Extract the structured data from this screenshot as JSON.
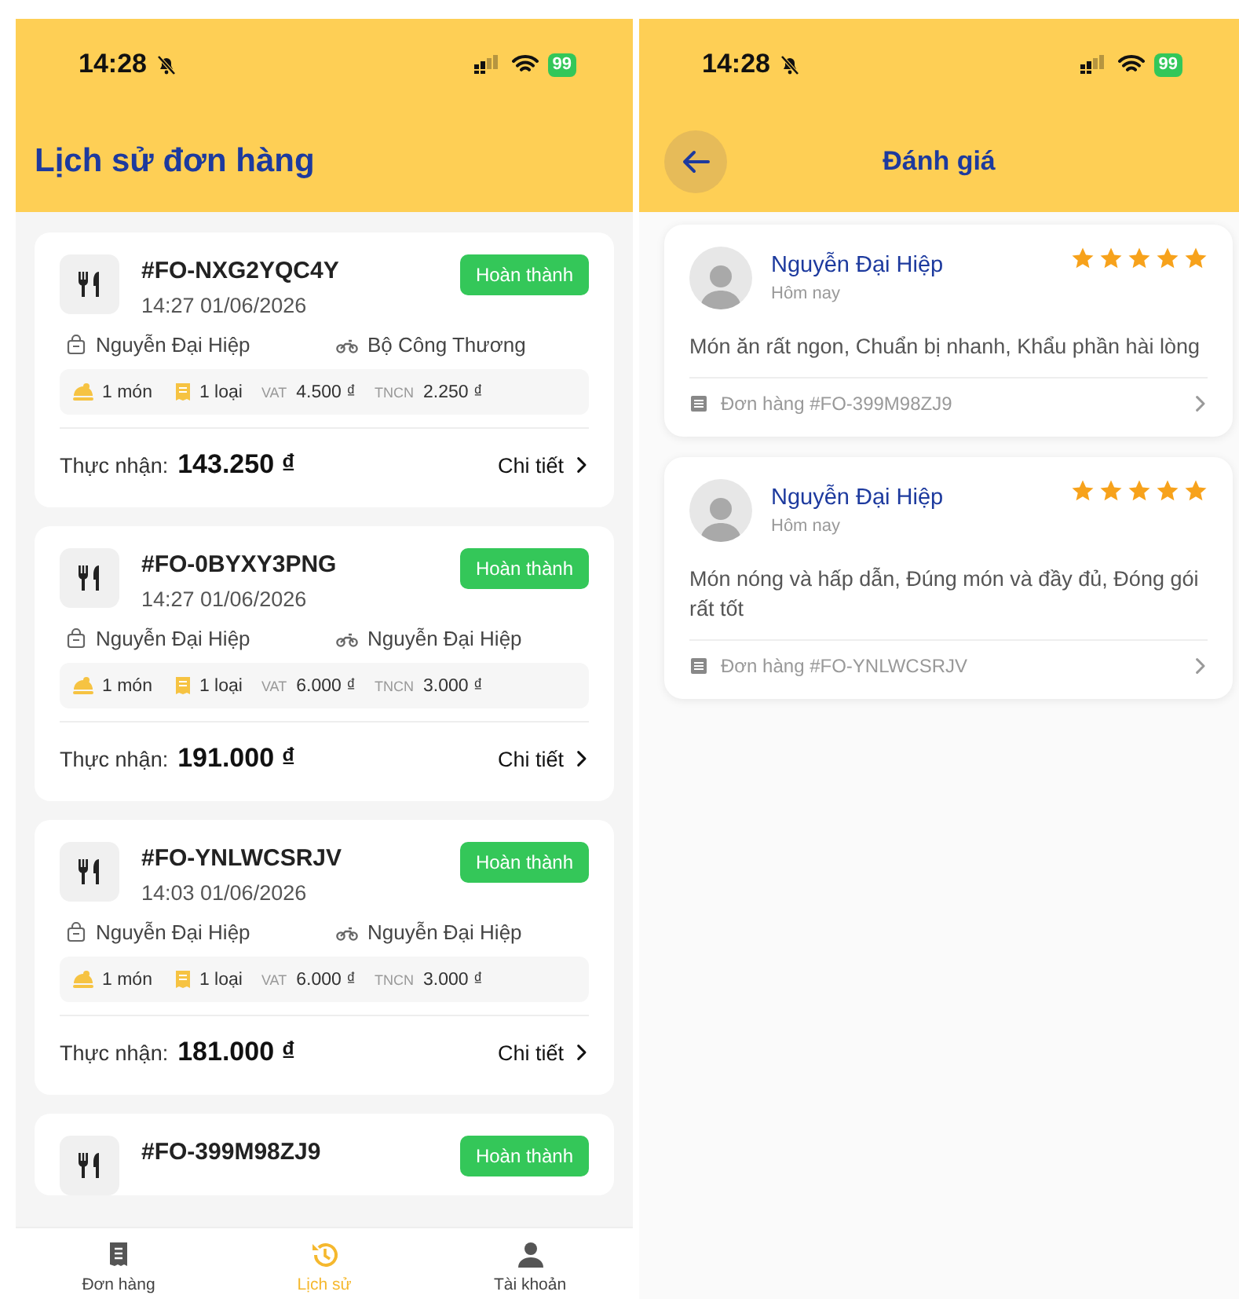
{
  "order_history": {
    "status_bar": {
      "time": "14:28",
      "battery": "99"
    },
    "title": "Lịch sử đơn hàng",
    "orders": [
      {
        "id": "#FO-NXG2YQC4Y",
        "time": "14:27 01/06/2026",
        "status": "Hoàn thành",
        "customer": "Nguyễn Đại Hiệp",
        "shipper": "Bộ Công Thương",
        "items": "1 món",
        "types": "1 loại",
        "vat_label": "VAT",
        "vat": "4.500 ₫",
        "tncn_label": "TNCN",
        "tncn": "2.250 ₫",
        "received_label": "Thực nhận:",
        "received": "143.250 ₫",
        "detail": "Chi tiết"
      },
      {
        "id": "#FO-0BYXY3PNG",
        "time": "14:27 01/06/2026",
        "status": "Hoàn thành",
        "customer": "Nguyễn Đại Hiệp",
        "shipper": "Nguyễn Đại Hiệp",
        "items": "1 món",
        "types": "1 loại",
        "vat_label": "VAT",
        "vat": "6.000 ₫",
        "tncn_label": "TNCN",
        "tncn": "3.000 ₫",
        "received_label": "Thực nhận:",
        "received": "191.000 ₫",
        "detail": "Chi tiết"
      },
      {
        "id": "#FO-YNLWCSRJV",
        "time": "14:03 01/06/2026",
        "status": "Hoàn thành",
        "customer": "Nguyễn Đại Hiệp",
        "shipper": "Nguyễn Đại Hiệp",
        "items": "1 món",
        "types": "1 loại",
        "vat_label": "VAT",
        "vat": "6.000 ₫",
        "tncn_label": "TNCN",
        "tncn": "3.000 ₫",
        "received_label": "Thực nhận:",
        "received": "181.000 ₫",
        "detail": "Chi tiết"
      },
      {
        "id": "#FO-399M98ZJ9",
        "status": "Hoàn thành"
      }
    ],
    "tab_bar": [
      {
        "label": "Đơn hàng",
        "kind": "orders",
        "selected": false
      },
      {
        "label": "Lịch sử",
        "kind": "history",
        "selected": true
      },
      {
        "label": "Tài khoản",
        "kind": "account",
        "selected": false
      }
    ]
  },
  "reviews_screen": {
    "status_bar": {
      "time": "14:28",
      "battery": "99"
    },
    "title": "Đánh giá",
    "reviews": [
      {
        "name": "Nguyễn Đại Hiệp",
        "date": "Hôm nay",
        "stars": 5,
        "comment": "Món ăn rất ngon, Chuẩn bị nhanh, Khẩu phần hài lòng",
        "order": "Đơn hàng #FO-399M98ZJ9"
      },
      {
        "name": "Nguyễn Đại Hiệp",
        "date": "Hôm nay",
        "stars": 5,
        "comment": "Món nóng và hấp dẫn, Đúng món và đầy đủ, Đóng gói rất tốt",
        "order": "Đơn hàng #FO-YNLWCSRJV"
      }
    ]
  }
}
